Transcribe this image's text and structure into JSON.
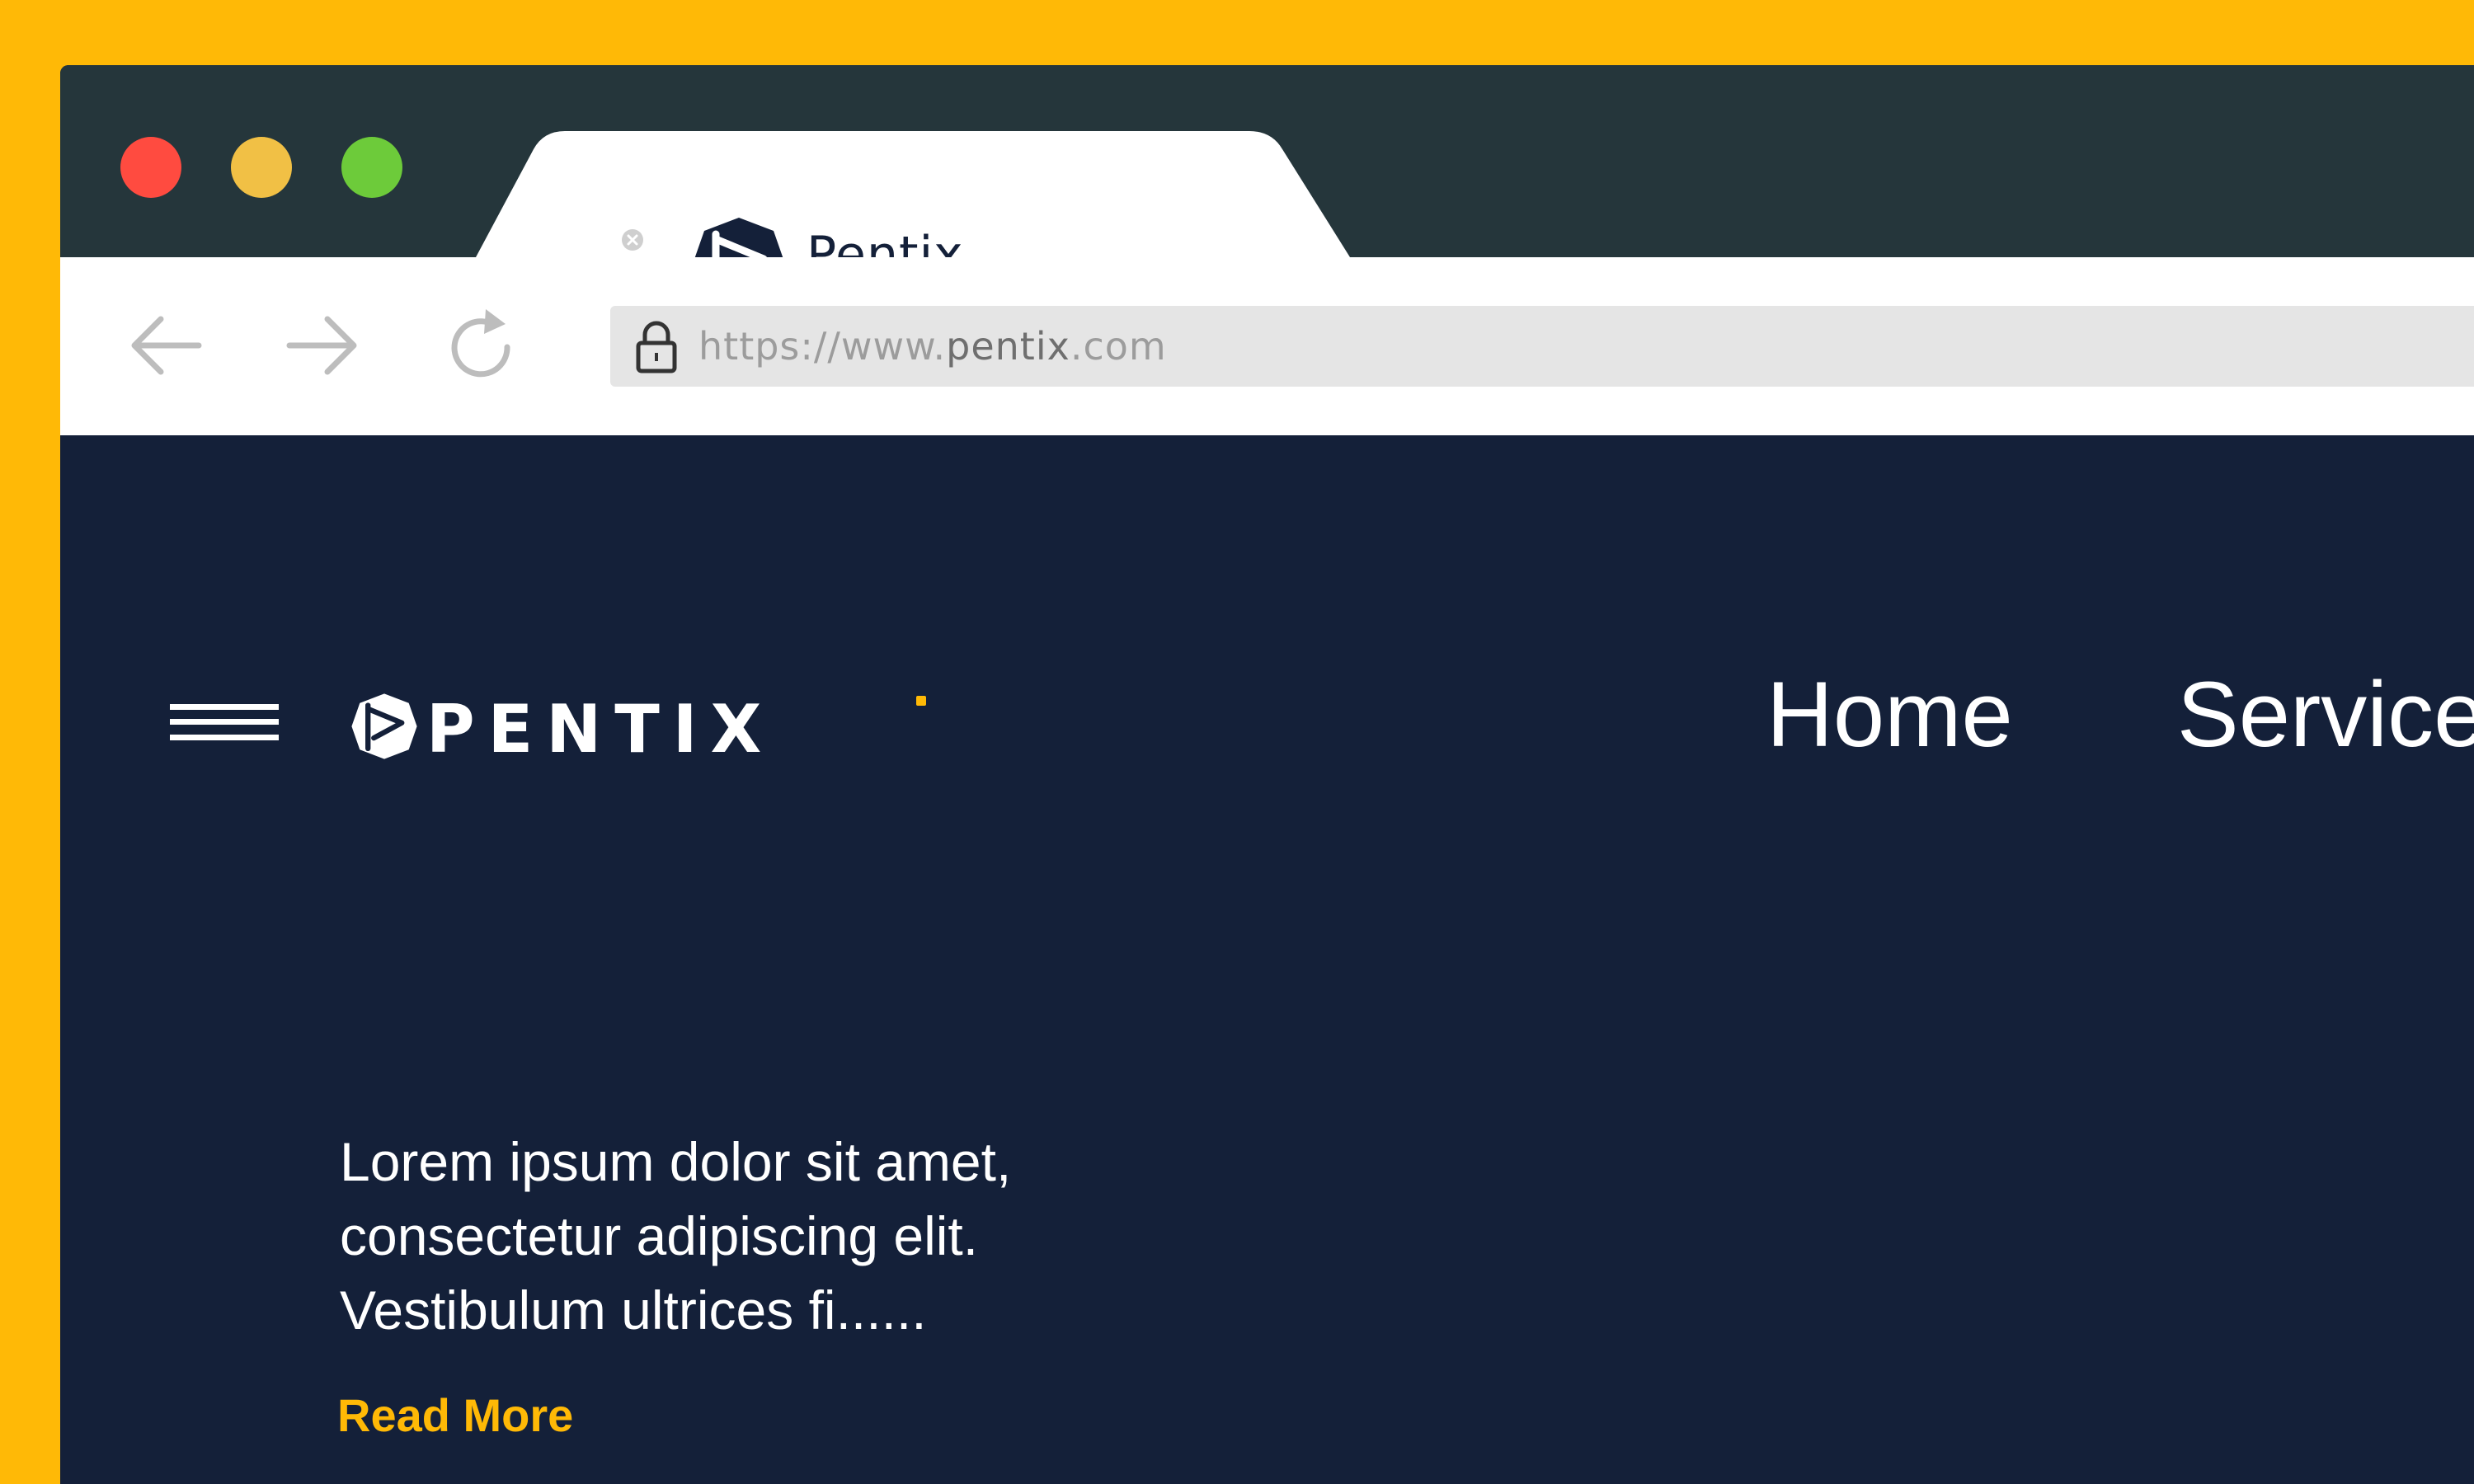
{
  "colors": {
    "background": "#FFB906",
    "titlebar": "#25363B",
    "page": "#142039",
    "accent": "#FFB906",
    "close_dot": "#FF4B40",
    "minimize_dot": "#F1C045",
    "maximize_dot": "#6DCB3A"
  },
  "window_controls": {
    "close": "red-dot-icon",
    "minimize": "yellow-dot-icon",
    "maximize": "green-dot-icon"
  },
  "tab": {
    "title": "Pentix",
    "favicon": "pentix-logo-icon",
    "close_icon": "close-icon"
  },
  "toolbar": {
    "back_icon": "arrow-left-icon",
    "forward_icon": "arrow-right-icon",
    "reload_icon": "reload-icon",
    "lock_icon": "lock-icon",
    "url_prefix": "https://www.",
    "url_host": "pentix",
    "url_suffix": ".com"
  },
  "site": {
    "menu_icon": "hamburger-menu-icon",
    "logo_text": "PENTIX",
    "nav": {
      "home": "Home",
      "services": "Service"
    },
    "hero": {
      "lines": [
        "Lorem ipsum dolor sit amet,",
        "consectetur adipiscing elit.",
        "Vestibulum ultrices fi......"
      ],
      "read_more": "Read More"
    }
  }
}
